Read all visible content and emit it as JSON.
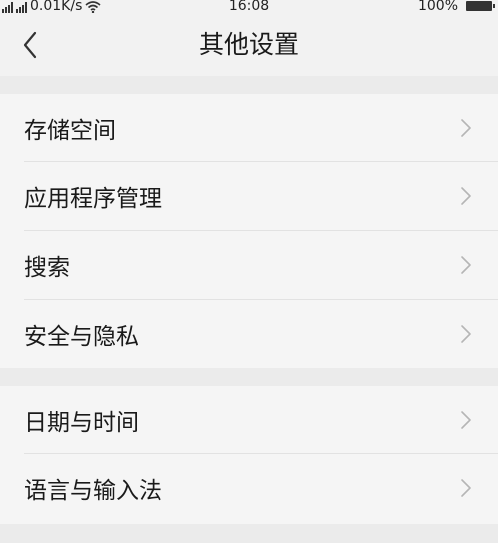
{
  "status_bar": {
    "network_speed": "0.01K/s",
    "time": "16:08",
    "battery": "100%"
  },
  "header": {
    "title": "其他设置",
    "back_icon": "chevron-left-icon"
  },
  "groups": [
    {
      "items": [
        {
          "label": "存储空间"
        },
        {
          "label": "应用程序管理"
        },
        {
          "label": "搜索"
        },
        {
          "label": "安全与隐私"
        }
      ]
    },
    {
      "items": [
        {
          "label": "日期与时间"
        },
        {
          "label": "语言与输入法"
        }
      ]
    }
  ],
  "colors": {
    "background": "#ebebeb",
    "panel": "#f5f5f5",
    "header": "#f2f2f2",
    "text": "#1a1a1a",
    "chevron": "#b5b5b5"
  }
}
